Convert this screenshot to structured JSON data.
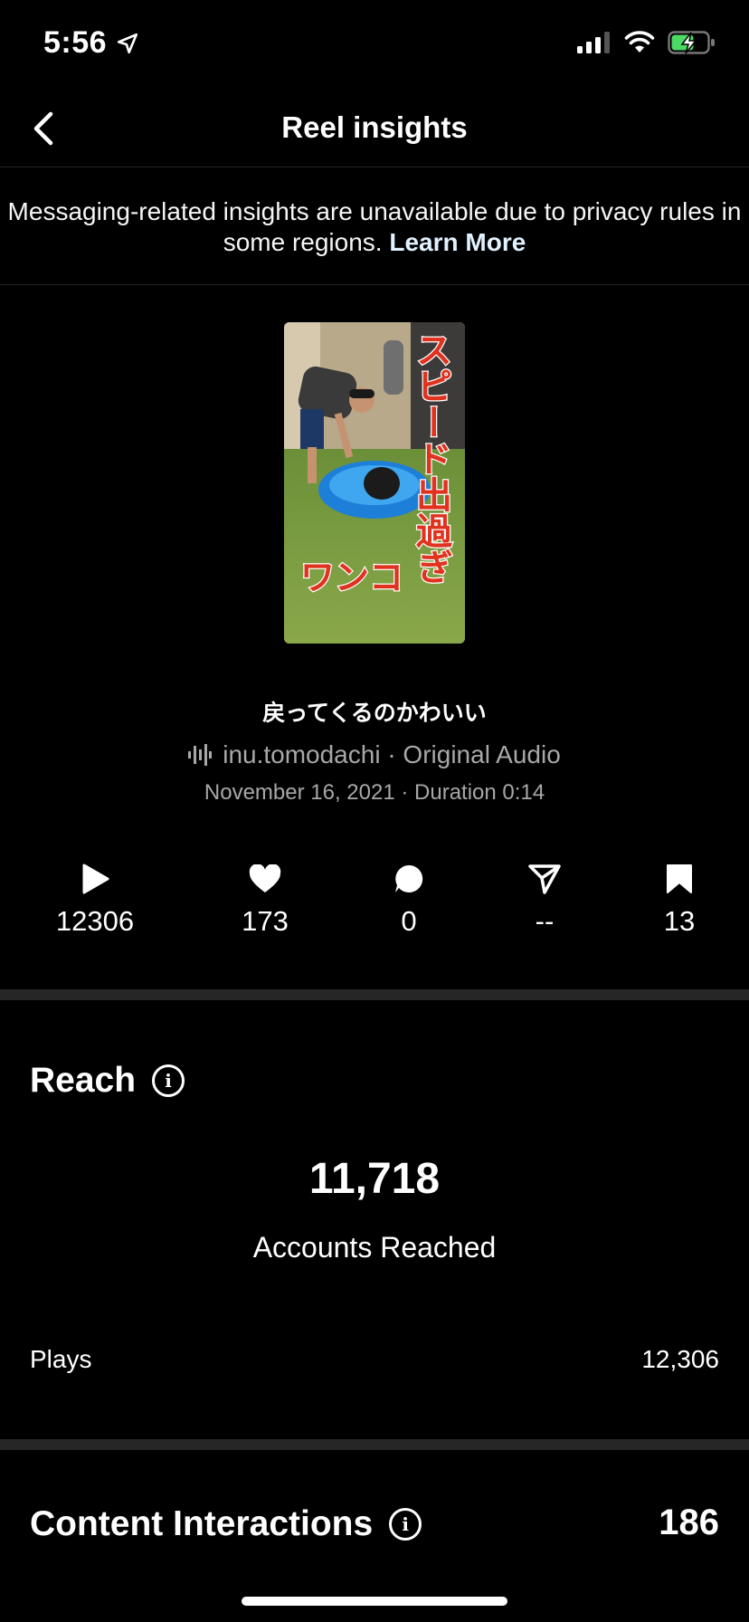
{
  "status_bar": {
    "time": "5:56"
  },
  "nav": {
    "title": "Reel insights"
  },
  "notice": {
    "text": "Messaging-related insights are unavailable due to privacy rules in some regions.",
    "link": "Learn More"
  },
  "reel": {
    "overlay_text_vertical": "スピード出過ぎ",
    "overlay_text_bottom": "ワンコ",
    "caption": "戻ってくるのかわいい",
    "audio": "inu.tomodachi · Original Audio",
    "date_duration": "November 16, 2021 · Duration 0:14"
  },
  "metrics": [
    {
      "icon": "play-icon",
      "value": "12306"
    },
    {
      "icon": "heart-icon",
      "value": "173"
    },
    {
      "icon": "comment-icon",
      "value": "0"
    },
    {
      "icon": "share-icon",
      "value": "--"
    },
    {
      "icon": "bookmark-icon",
      "value": "13"
    }
  ],
  "reach": {
    "title": "Reach",
    "number": "11,718",
    "label": "Accounts Reached",
    "plays_label": "Plays",
    "plays_value": "12,306"
  },
  "interactions": {
    "title": "Content Interactions",
    "value": "186"
  },
  "colors": {
    "background": "#000000",
    "divider": "#262626",
    "muted_text": "#a8a8a8",
    "battery": "#4cd964",
    "overlay_red": "#e0321e"
  }
}
